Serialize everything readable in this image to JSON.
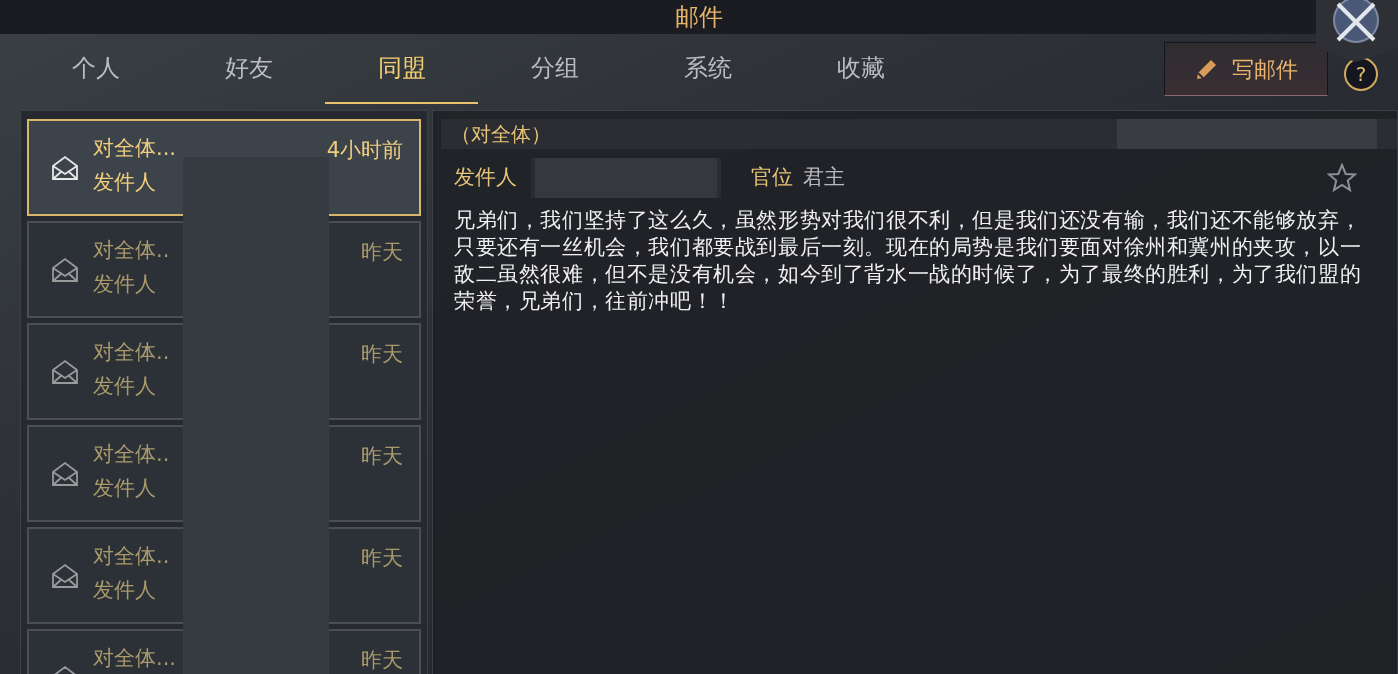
{
  "window": {
    "title": "邮件"
  },
  "tabs": [
    {
      "label": "个人",
      "selected": false
    },
    {
      "label": "好友",
      "selected": false
    },
    {
      "label": "同盟",
      "selected": true
    },
    {
      "label": "分组",
      "selected": false
    },
    {
      "label": "系统",
      "selected": false
    },
    {
      "label": "收藏",
      "selected": false
    }
  ],
  "compose_button": {
    "label": "写邮件"
  },
  "help_button": {
    "label": "?"
  },
  "mail_list": [
    {
      "subject": "对全体...",
      "sender_label": "发件人",
      "time": "4小时前",
      "selected": true
    },
    {
      "subject": "对全体..",
      "sender_label": "发件人",
      "time": "昨天",
      "selected": false
    },
    {
      "subject": "对全体..",
      "sender_label": "发件人",
      "time": "昨天",
      "selected": false
    },
    {
      "subject": "对全体..",
      "sender_label": "发件人",
      "time": "昨天",
      "selected": false
    },
    {
      "subject": "对全体..",
      "sender_label": "发件人",
      "time": "昨天",
      "selected": false
    },
    {
      "subject": "对全体...",
      "time": "昨天",
      "selected": false
    }
  ],
  "mail_detail": {
    "subject": "（对全体）",
    "sender_label": "发件人",
    "rank_label": "官位",
    "rank_value": "君主",
    "favorite": false,
    "body": "兄弟们，我们坚持了这么久，虽然形势对我们很不利，但是我们还没有输，我们还不能够放弃，只要还有一丝机会，我们都要战到最后一刻。现在的局势是我们要面对徐州和冀州的夹攻，以一敌二虽然很难，但不是没有机会，如今到了背水一战的时候了，为了最终的胜利，为了我们盟的荣誉，兄弟们，往前冲吧！！"
  }
}
